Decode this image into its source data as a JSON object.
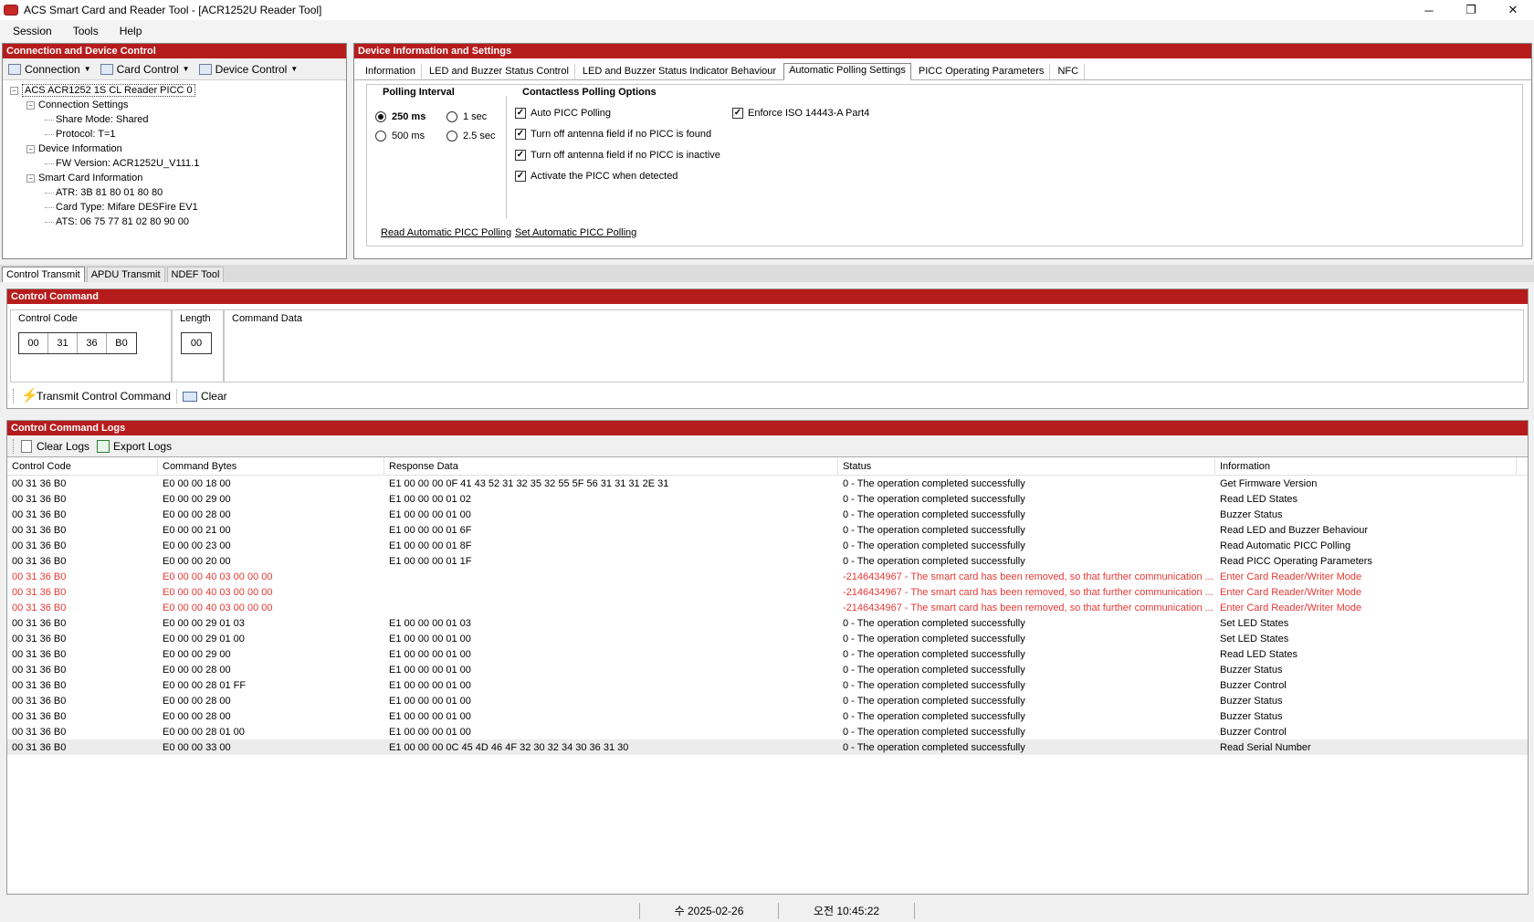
{
  "window": {
    "title": "ACS Smart Card and Reader Tool - [ACR1252U Reader Tool]",
    "controls": [
      "─",
      "❐",
      "✕"
    ]
  },
  "menu": [
    "Session",
    "Tools",
    "Help"
  ],
  "left": {
    "header": "Connection and Device Control",
    "toolbar": [
      "Connection",
      "Card Control",
      "Device Control"
    ],
    "tree": {
      "root": "ACS ACR1252 1S CL Reader PICC 0",
      "connection_settings": "Connection Settings",
      "share_mode": "Share Mode: Shared",
      "protocol": "Protocol: T=1",
      "device_information": "Device Information",
      "fw_version": "FW Version: ACR1252U_V111.1",
      "smart_card_information": "Smart Card Information",
      "atr": "ATR: 3B 81 80 01 80 80",
      "card_type": "Card Type: Mifare DESFire EV1",
      "ats": "ATS: 06 75 77 81 02 80 90 00"
    }
  },
  "right": {
    "header": "Device Information and Settings",
    "tabs": [
      "Information",
      "LED and Buzzer Status Control",
      "LED and Buzzer Status Indicator Behaviour",
      "Automatic Polling Settings",
      "PICC Operating Parameters",
      "NFC"
    ],
    "polling_interval": {
      "title": "Polling Interval",
      "opt_250": "250 ms",
      "opt_1s": "1 sec",
      "opt_500": "500 ms",
      "opt_25s": "2.5 sec"
    },
    "contactless": {
      "title": "Contactless Polling Options",
      "auto_picc": "Auto PICC Polling",
      "antenna_not_found": "Turn off antenna field if no PICC is found",
      "antenna_inactive": "Turn off antenna field if no PICC is inactive",
      "activate_picc": "Activate the PICC when detected",
      "enforce_iso": "Enforce ISO 14443-A Part4"
    },
    "read_link": "Read Automatic PICC Polling",
    "set_link": "Set Automatic PICC Polling"
  },
  "bottom_tabs": [
    "Control Transmit",
    "APDU Transmit",
    "NDEF Tool"
  ],
  "control": {
    "header": "Control Command",
    "control_code_label": "Control Code",
    "code": [
      "00",
      "31",
      "36",
      "B0"
    ],
    "length_label": "Length",
    "length": "00",
    "command_data_label": "Command Data",
    "transmit": "Transmit Control Command",
    "clear": "Clear"
  },
  "logs": {
    "header": "Control Command Logs",
    "clear_logs": "Clear Logs",
    "export_logs": "Export Logs",
    "columns": [
      "Control Code",
      "Command Bytes",
      "Response Data",
      "Status",
      "Information"
    ],
    "rows": [
      [
        "00 31 36 B0",
        "E0 00 00 18 00",
        "E1 00 00 00 0F 41 43 52 31 32 35 32 55 5F 56 31 31 31 2E 31",
        "0 - The operation completed successfully",
        "Get Firmware Version"
      ],
      [
        "00 31 36 B0",
        "E0 00 00 29 00",
        "E1 00 00 00 01 02",
        "0 - The operation completed successfully",
        "Read LED States"
      ],
      [
        "00 31 36 B0",
        "E0 00 00 28 00",
        "E1 00 00 00 01 00",
        "0 - The operation completed successfully",
        "Buzzer Status"
      ],
      [
        "00 31 36 B0",
        "E0 00 00 21 00",
        "E1 00 00 00 01 6F",
        "0 - The operation completed successfully",
        "Read LED and Buzzer Behaviour"
      ],
      [
        "00 31 36 B0",
        "E0 00 00 23 00",
        "E1 00 00 00 01 8F",
        "0 - The operation completed successfully",
        "Read Automatic PICC Polling"
      ],
      [
        "00 31 36 B0",
        "E0 00 00 20 00",
        "E1 00 00 00 01 1F",
        "0 - The operation completed successfully",
        "Read PICC Operating Parameters"
      ],
      [
        "00 31 36 B0",
        "E0 00 00 40 03 00 00 00",
        "",
        "-2146434967 - The smart card has been removed, so that further communication ...",
        "Enter Card Reader/Writer Mode"
      ],
      [
        "00 31 36 B0",
        "E0 00 00 40 03 00 00 00",
        "",
        "-2146434967 - The smart card has been removed, so that further communication ...",
        "Enter Card Reader/Writer Mode"
      ],
      [
        "00 31 36 B0",
        "E0 00 00 40 03 00 00 00",
        "",
        "-2146434967 - The smart card has been removed, so that further communication ...",
        "Enter Card Reader/Writer Mode"
      ],
      [
        "00 31 36 B0",
        "E0 00 00 29 01 03",
        "E1 00 00 00 01 03",
        "0 - The operation completed successfully",
        "Set LED States"
      ],
      [
        "00 31 36 B0",
        "E0 00 00 29 01 00",
        "E1 00 00 00 01 00",
        "0 - The operation completed successfully",
        "Set LED States"
      ],
      [
        "00 31 36 B0",
        "E0 00 00 29 00",
        "E1 00 00 00 01 00",
        "0 - The operation completed successfully",
        "Read LED States"
      ],
      [
        "00 31 36 B0",
        "E0 00 00 28 00",
        "E1 00 00 00 01 00",
        "0 - The operation completed successfully",
        "Buzzer Status"
      ],
      [
        "00 31 36 B0",
        "E0 00 00 28 01 FF",
        "E1 00 00 00 01 00",
        "0 - The operation completed successfully",
        "Buzzer Control"
      ],
      [
        "00 31 36 B0",
        "E0 00 00 28 00",
        "E1 00 00 00 01 00",
        "0 - The operation completed successfully",
        "Buzzer Status"
      ],
      [
        "00 31 36 B0",
        "E0 00 00 28 00",
        "E1 00 00 00 01 00",
        "0 - The operation completed successfully",
        "Buzzer Status"
      ],
      [
        "00 31 36 B0",
        "E0 00 00 28 01 00",
        "E1 00 00 00 01 00",
        "0 - The operation completed successfully",
        "Buzzer Control"
      ],
      [
        "00 31 36 B0",
        "E0 00 00 33 00",
        "E1 00 00 00 0C 45 4D 46 4F 32 30 32 34 30 36 31 30",
        "0 - The operation completed successfully",
        "Read Serial Number"
      ]
    ],
    "error_rows": [
      6,
      7,
      8
    ],
    "highlight_row": 17
  },
  "status": {
    "date": "수 2025-02-26",
    "time": "오전 10:45:22"
  },
  "colors": {
    "header_red": "#b71c1c",
    "error_text": "#e53935"
  }
}
